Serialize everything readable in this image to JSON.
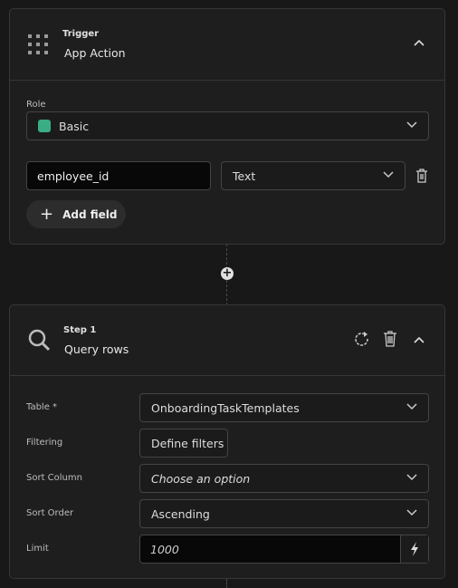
{
  "trigger": {
    "kicker": "Trigger",
    "title": "App Action",
    "icon": "grid-icon",
    "role_label": "Role",
    "role_value": "Basic",
    "role_color": "#3aad85",
    "field_name": "employee_id",
    "field_type": "Text",
    "add_field_label": "Add field"
  },
  "step": {
    "kicker": "Step 1",
    "title": "Query rows",
    "icon": "search-icon",
    "rows": [
      {
        "label": "Table *",
        "value": "OnboardingTaskTemplates"
      },
      {
        "label": "Filtering",
        "value": "Define filters"
      },
      {
        "label": "Sort Column",
        "placeholder": "Choose an option"
      },
      {
        "label": "Sort Order",
        "value": "Ascending"
      },
      {
        "label": "Limit",
        "placeholder": "1000"
      }
    ]
  }
}
